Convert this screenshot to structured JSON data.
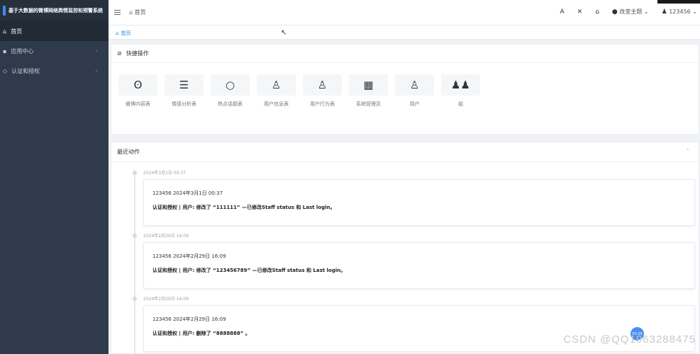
{
  "sidebar": {
    "brand": "基于大数据的微博网络舆情监控和预警系统",
    "items": [
      {
        "label": "首页",
        "active": true
      },
      {
        "label": "应用中心"
      },
      {
        "label": "认证和授权"
      }
    ]
  },
  "topbar": {
    "breadcrumb": "首页",
    "theme": "改变主题",
    "user": "123456"
  },
  "tab": {
    "label": "首页"
  },
  "quick": {
    "title": "快捷操作",
    "items": [
      {
        "label": "微博内容表",
        "icon": "weibo-icon"
      },
      {
        "label": "情感分析表",
        "icon": "list-icon"
      },
      {
        "label": "热点话题表",
        "icon": "circle-icon"
      },
      {
        "label": "用户信息表",
        "icon": "user-icon"
      },
      {
        "label": "用户行为表",
        "icon": "user-icon"
      },
      {
        "label": "系统管理员",
        "icon": "grid-icon"
      },
      {
        "label": "用户",
        "icon": "user-icon"
      },
      {
        "label": "组",
        "icon": "users-icon"
      }
    ]
  },
  "recent": {
    "title": "最近动作",
    "entries": [
      {
        "date": "2024年3月1日 00:37",
        "line1": "123456 2024年3月1日 00:37",
        "line2": "认证和授权 | 用户: 修改了 “111111” —已修改Staff status 和 Last login。"
      },
      {
        "date": "2024年2月29日 16:09",
        "line1": "123456 2024年2月29日 16:09",
        "line2": "认证和授权 | 用户: 修改了 “123456789” —已修改Staff status 和 Last login。"
      },
      {
        "date": "2024年2月29日 16:09",
        "line1": "123456 2024年2月29日 16:09",
        "line2": "认证和授权 | 用户: 删除了 “8888888” 。"
      }
    ]
  },
  "badge": "00:29",
  "watermark": "CSDN @QQ1963288475"
}
